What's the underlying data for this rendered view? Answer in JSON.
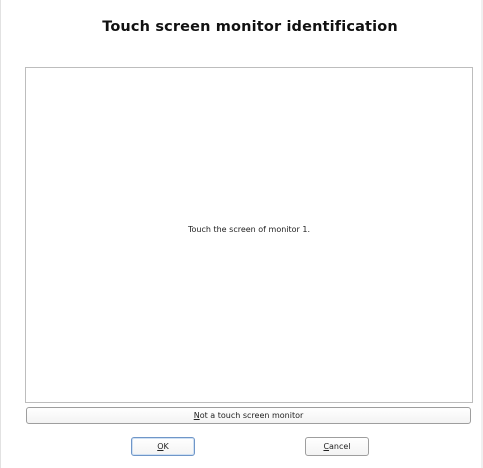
{
  "dialog": {
    "title": "Touch screen monitor identification",
    "instruction": "Touch the screen of monitor 1."
  },
  "buttons": {
    "not_touch": {
      "mnemonic": "N",
      "rest": "ot a touch screen monitor"
    },
    "ok": {
      "mnemonic": "O",
      "rest": "K"
    },
    "cancel": {
      "mnemonic": "C",
      "rest": "ancel"
    }
  }
}
